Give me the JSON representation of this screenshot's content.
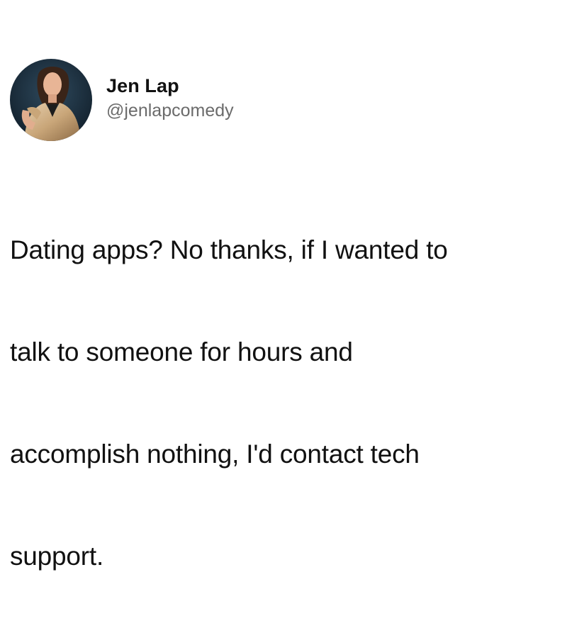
{
  "tweet": {
    "author": {
      "display_name": "Jen Lap",
      "handle": "@jenlapcomedy",
      "avatar_icon": "profile-photo"
    },
    "text_lines": [
      "Dating apps? No thanks, if I wanted to",
      "talk to someone for hours and",
      "accomplish nothing, I'd contact tech",
      "support."
    ]
  },
  "colors": {
    "background": "#ffffff",
    "text": "#111111",
    "handle": "#6b6b6b"
  }
}
